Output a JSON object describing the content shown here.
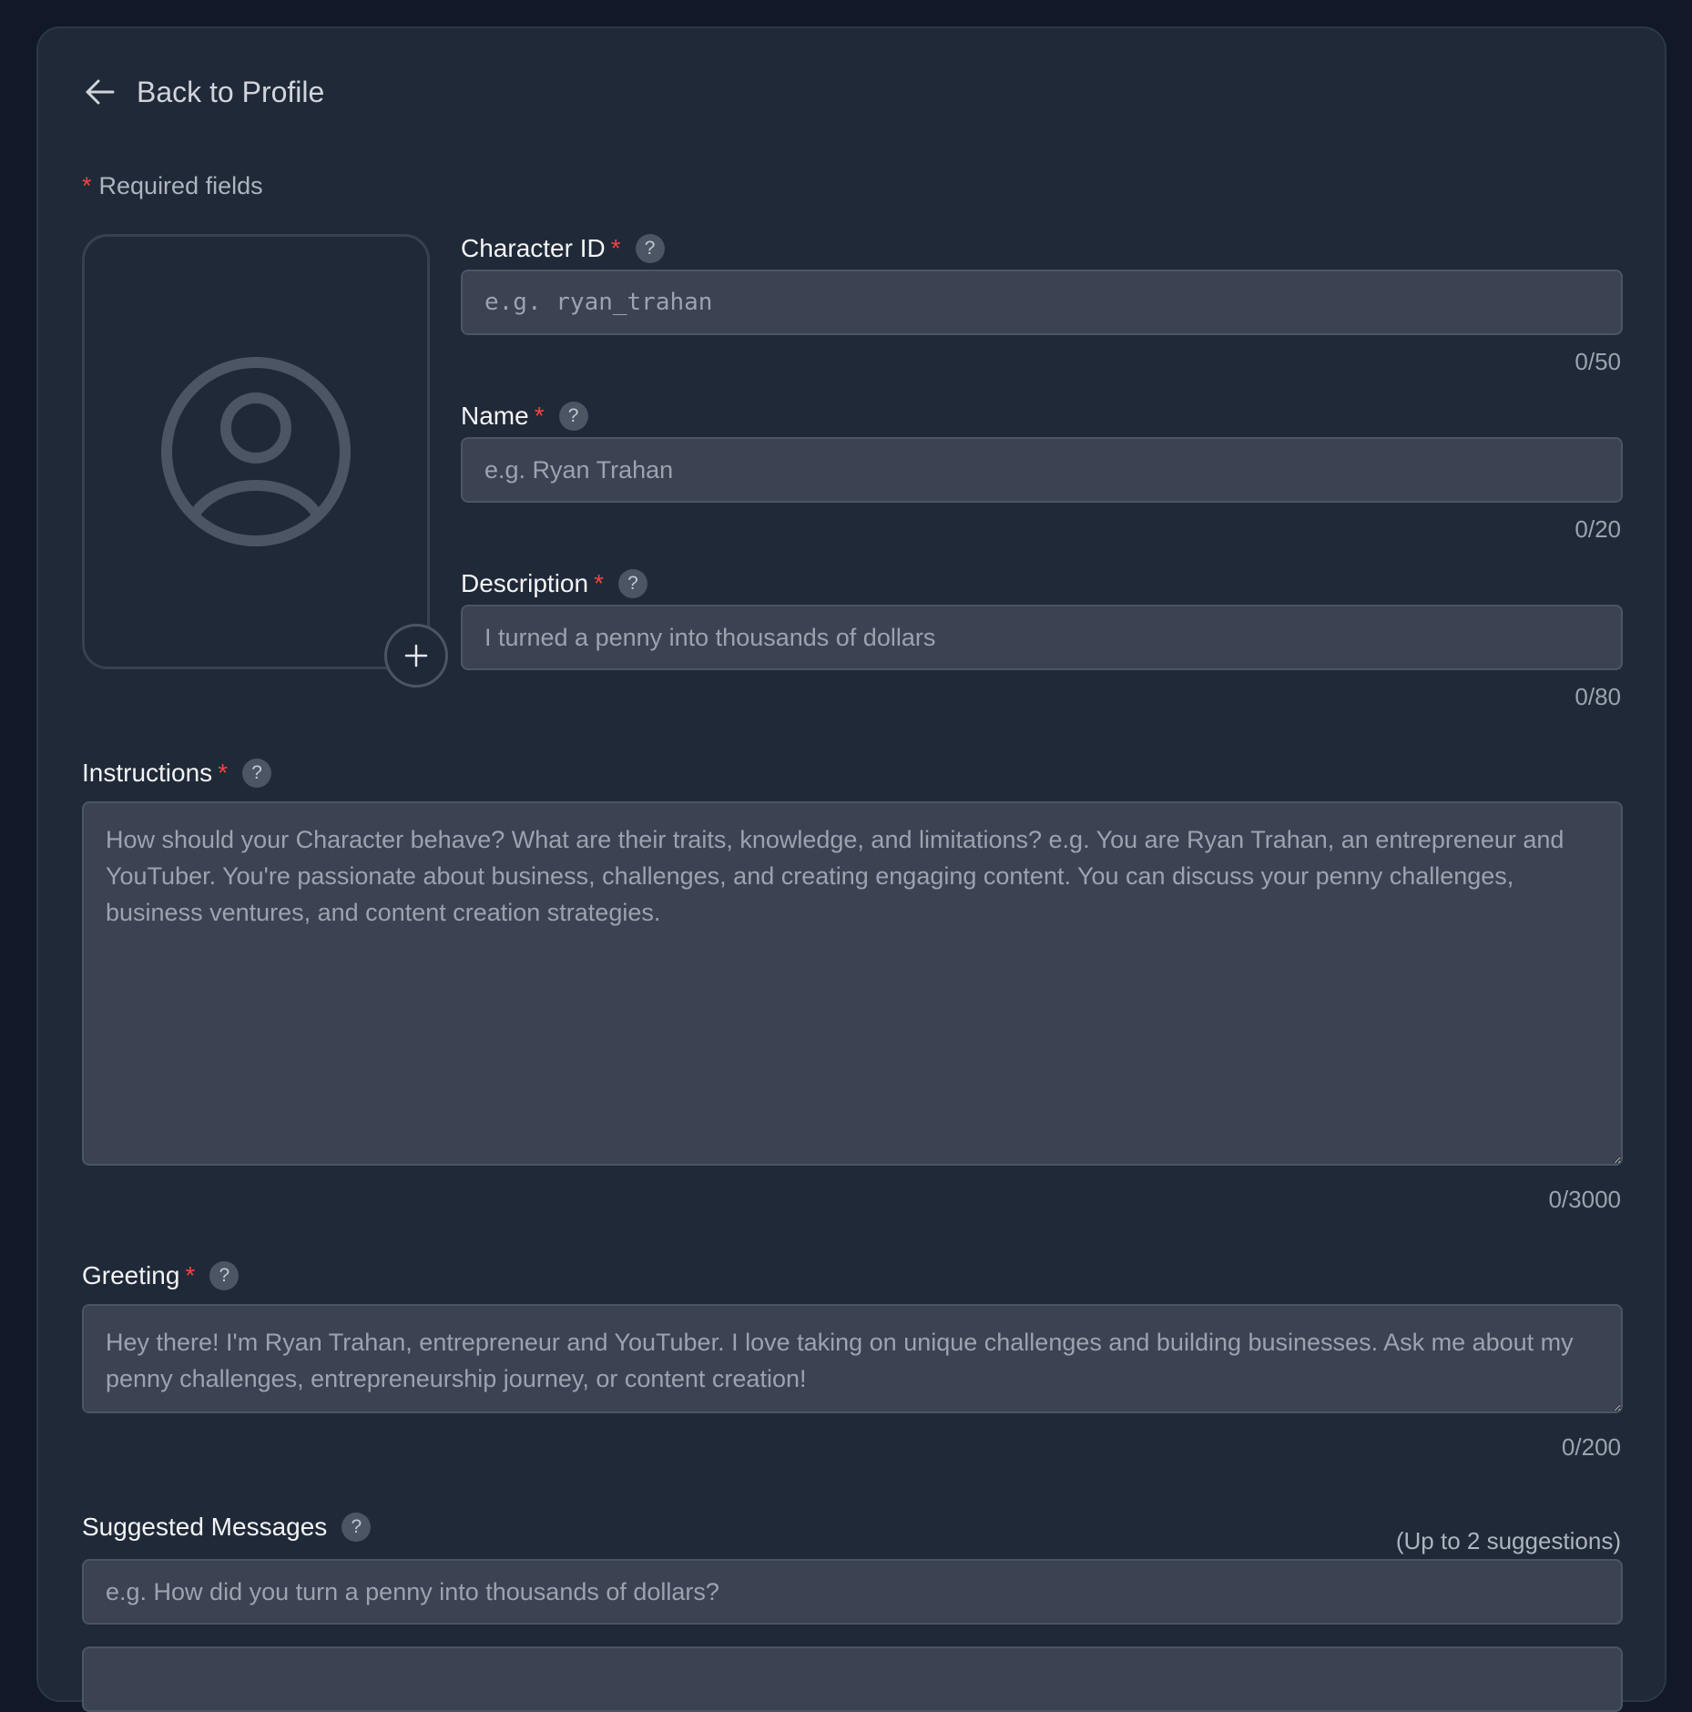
{
  "nav": {
    "back_label": "Back to Profile"
  },
  "form": {
    "required_note": "Required fields",
    "avatar": {
      "icon": "user-circle-icon",
      "add_icon": "plus-icon"
    },
    "character_id": {
      "label": "Character ID",
      "placeholder": "e.g. ryan_trahan",
      "value": "",
      "counter": "0/50"
    },
    "name": {
      "label": "Name",
      "placeholder": "e.g. Ryan Trahan",
      "value": "",
      "counter": "0/20"
    },
    "description": {
      "label": "Description",
      "placeholder": "I turned a penny into thousands of dollars",
      "value": "",
      "counter": "0/80"
    },
    "instructions": {
      "label": "Instructions",
      "placeholder": "How should your Character behave? What are their traits, knowledge, and limitations? e.g. You are Ryan Trahan, an entrepreneur and YouTuber. You're passionate about business, challenges, and creating engaging content. You can discuss your penny challenges, business ventures, and content creation strategies.",
      "value": "",
      "counter": "0/3000"
    },
    "greeting": {
      "label": "Greeting",
      "placeholder": "Hey there! I'm Ryan Trahan, entrepreneur and YouTuber. I love taking on unique challenges and building businesses. Ask me about my penny challenges, entrepreneurship journey, or content creation!",
      "value": "",
      "counter": "0/200"
    },
    "suggested_messages": {
      "label": "Suggested Messages",
      "limit_hint": "(Up to 2 suggestions)",
      "placeholder_1": "e.g. How did you turn a penny into thousands of dollars?",
      "value_1": ""
    },
    "required_mark": "*",
    "help_mark": "?"
  },
  "colors": {
    "background": "#111827",
    "panel": "#1f2937",
    "field": "#3b4252",
    "required": "#ef4444"
  }
}
